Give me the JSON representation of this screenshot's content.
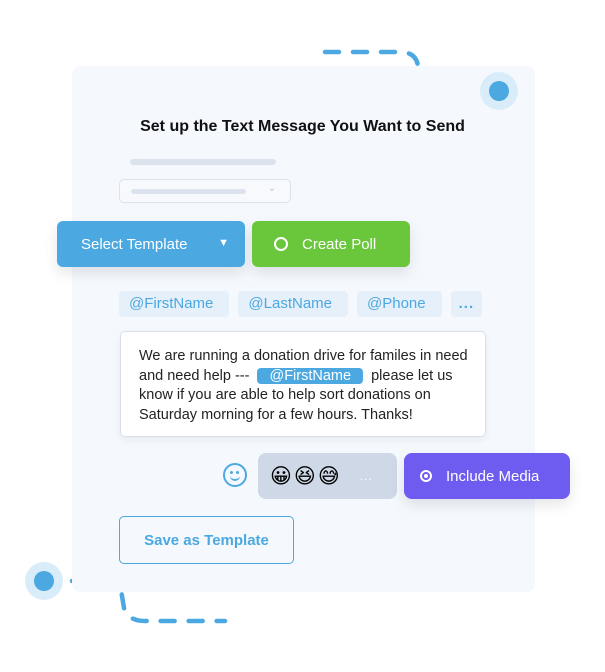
{
  "header": {
    "title": "Set up the Text Message You Want to Send"
  },
  "toolbar": {
    "select_template_label": "Select Template",
    "select_template_caret": "▼",
    "create_poll_label": "Create Poll",
    "include_media_label": "Include Media",
    "save_template_label": "Save as Template"
  },
  "placeholder": {
    "select_chevron": "⌄"
  },
  "merge_tags": [
    "@FirstName",
    "@LastName",
    "@Phone",
    "..."
  ],
  "message": {
    "before_chip": "We are running a donation drive for familes in need and need help ---",
    "chip": "@FirstName",
    "after_chip": "please let us know if you are able to help sort donations on Saturday morning for a few hours. Thanks!"
  },
  "emoji_picker": {
    "emojis": [
      "😀",
      "😆",
      "😅"
    ],
    "more": "..."
  },
  "colors": {
    "primary_blue": "#4ba8e0",
    "poll_green": "#6ac73c",
    "media_purple": "#6e5bf0",
    "card_bg": "#f5f9fe"
  }
}
